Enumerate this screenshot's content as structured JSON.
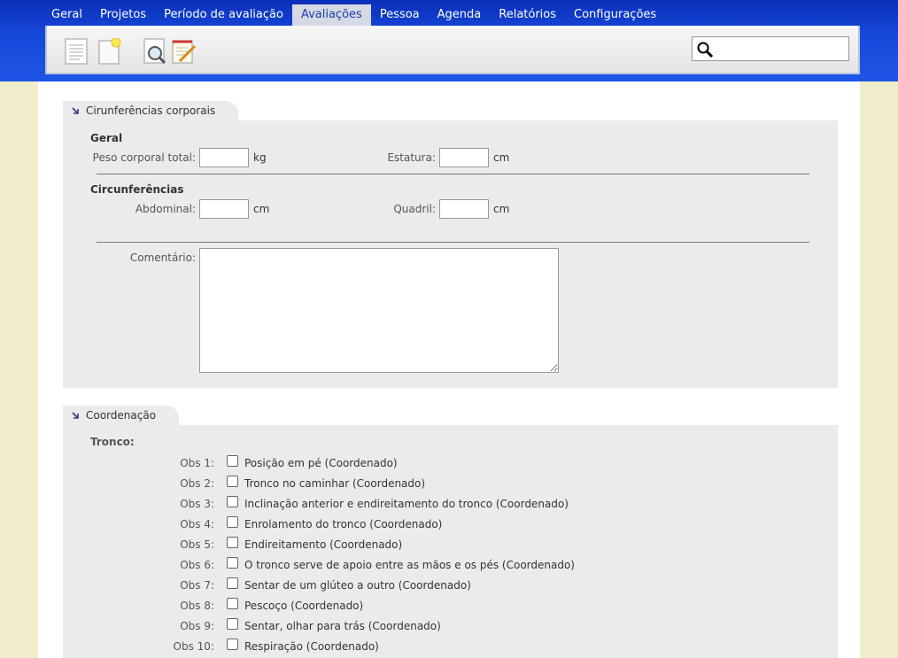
{
  "nav": {
    "items": [
      "Geral",
      "Projetos",
      "Período de avaliação",
      "Avaliações",
      "Pessoa",
      "Agenda",
      "Relatórios",
      "Configurações"
    ],
    "active": "Avaliações"
  },
  "toolbar": {
    "icons": [
      "document-icon",
      "new-note-icon",
      "preview-search-icon",
      "edit-notepad-icon"
    ],
    "search_value": ""
  },
  "section1": {
    "title": "Cirunferências corporais",
    "geral_title": "Geral",
    "peso_label": "Peso corporal total:",
    "peso_value": "",
    "peso_unit": "kg",
    "estatura_label": "Estatura:",
    "estatura_value": "",
    "estatura_unit": "cm",
    "circ_title": "Circunferências",
    "abdominal_label": "Abdominal:",
    "abdominal_value": "",
    "abdominal_unit": "cm",
    "quadril_label": "Quadril:",
    "quadril_value": "",
    "quadril_unit": "cm",
    "comentario_label": "Comentário:",
    "comentario_value": ""
  },
  "section2": {
    "title": "Coordenação",
    "tronco_title": "Tronco:",
    "obs": [
      {
        "num": "Obs 1:",
        "text": "Posição em pé (Coordenado)",
        "checked": false
      },
      {
        "num": "Obs 2:",
        "text": "Tronco no caminhar (Coordenado)",
        "checked": false
      },
      {
        "num": "Obs 3:",
        "text": "Inclinação anterior e endireitamento do tronco (Coordenado)",
        "checked": false
      },
      {
        "num": "Obs 4:",
        "text": "Enrolamento do tronco (Coordenado)",
        "checked": false
      },
      {
        "num": "Obs 5:",
        "text": "Endireitamento (Coordenado)",
        "checked": false
      },
      {
        "num": "Obs 6:",
        "text": "O tronco serve de apoio entre as mãos e os pés (Coordenado)",
        "checked": false
      },
      {
        "num": "Obs 7:",
        "text": "Sentar de um glúteo a outro (Coordenado)",
        "checked": false
      },
      {
        "num": "Obs 8:",
        "text": "Pescoço (Coordenado)",
        "checked": false
      },
      {
        "num": "Obs 9:",
        "text": "Sentar, olhar para trás (Coordenado)",
        "checked": false
      },
      {
        "num": "Obs 10:",
        "text": "Respiração (Coordenado)",
        "checked": false
      }
    ]
  }
}
